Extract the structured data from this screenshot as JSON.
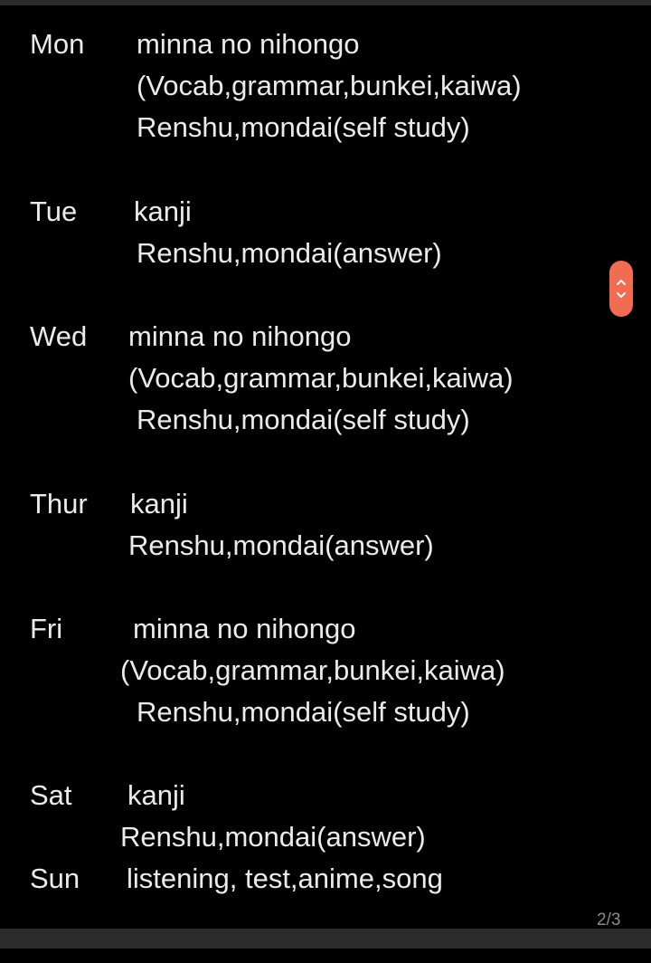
{
  "schedule": [
    {
      "day": "Mon",
      "lines": [
        "minna no nihongo",
        "(Vocab,grammar,bunkei,kaiwa)",
        "Renshu,mondai(self study)"
      ]
    },
    {
      "day": "Tue",
      "lines": [
        "kanji",
        "Renshu,mondai(answer)"
      ]
    },
    {
      "day": "Wed",
      "lines": [
        "minna no nihongo",
        "(Vocab,grammar,bunkei,kaiwa)",
        "Renshu,mondai(self study)"
      ]
    },
    {
      "day": "Thur",
      "lines": [
        "kanji",
        "Renshu,mondai(answer)"
      ]
    },
    {
      "day": "Fri",
      "lines": [
        "minna no nihongo",
        "(Vocab,grammar,bunkei,kaiwa)",
        "Renshu,mondai(self study)"
      ]
    },
    {
      "day": "Sat",
      "lines": [
        "kanji",
        "Renshu,mondai(answer)"
      ]
    },
    {
      "day": "Sun",
      "lines": [
        "listening, test,anime,song"
      ]
    }
  ],
  "page_indicator": "2/3",
  "scroll_handle": {
    "icon": "chevron-up-down-icon",
    "color": "#f26c52"
  }
}
